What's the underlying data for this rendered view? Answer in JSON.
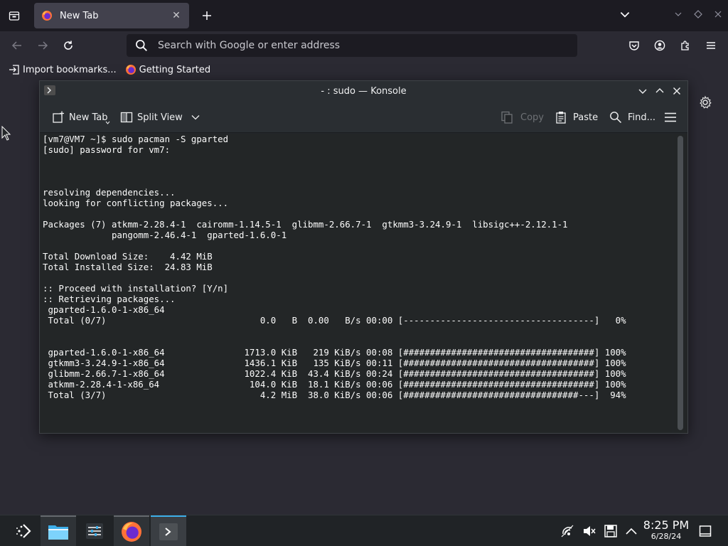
{
  "firefox": {
    "tab": {
      "title": "New Tab"
    },
    "urlbar": {
      "placeholder": "Search with Google or enter address"
    },
    "bookmarks": [
      {
        "label": "Import bookmarks..."
      },
      {
        "label": "Getting Started"
      }
    ]
  },
  "konsole": {
    "title": "- : sudo — Konsole",
    "toolbar": {
      "new_tab": "New Tab",
      "split_view": "Split View",
      "copy": "Copy",
      "paste": "Paste",
      "find": "Find..."
    },
    "lines": [
      "[vm7@VM7 ~]$ sudo pacman -S gparted",
      "[sudo] password for vm7:",
      "",
      "",
      "",
      "resolving dependencies...",
      "looking for conflicting packages...",
      "",
      "Packages (7) atkmm-2.28.4-1  cairomm-1.14.5-1  glibmm-2.66.7-1  gtkmm3-3.24.9-1  libsigc++-2.12.1-1",
      "             pangomm-2.46.4-1  gparted-1.6.0-1",
      "",
      "Total Download Size:    4.42 MiB",
      "Total Installed Size:  24.83 MiB",
      "",
      ":: Proceed with installation? [Y/n]",
      ":: Retrieving packages...",
      " gparted-1.6.0-1-x86_64",
      " Total (0/7)                             0.0   B  0.00   B/s 00:00 [------------------------------------]   0%",
      "",
      "",
      " gparted-1.6.0-1-x86_64               1713.0 KiB   219 KiB/s 00:08 [####################################] 100%",
      " gtkmm3-3.24.9-1-x86_64               1436.1 KiB   135 KiB/s 00:11 [####################################] 100%",
      " glibmm-2.66.7-1-x86_64               1022.4 KiB  43.4 KiB/s 00:24 [####################################] 100%",
      " atkmm-2.28.4-1-x86_64                 104.0 KiB  18.1 KiB/s 00:06 [####################################] 100%",
      " Total (3/7)                             4.2 MiB  38.0 KiB/s 00:06 [#################################---]  94%"
    ]
  },
  "taskbar": {
    "time": "8:25 PM",
    "date": "6/28/24"
  },
  "colors": {
    "accent": "#3daee9",
    "terminal_bg": "#232627",
    "firefox_bg": "#2b2a33"
  }
}
